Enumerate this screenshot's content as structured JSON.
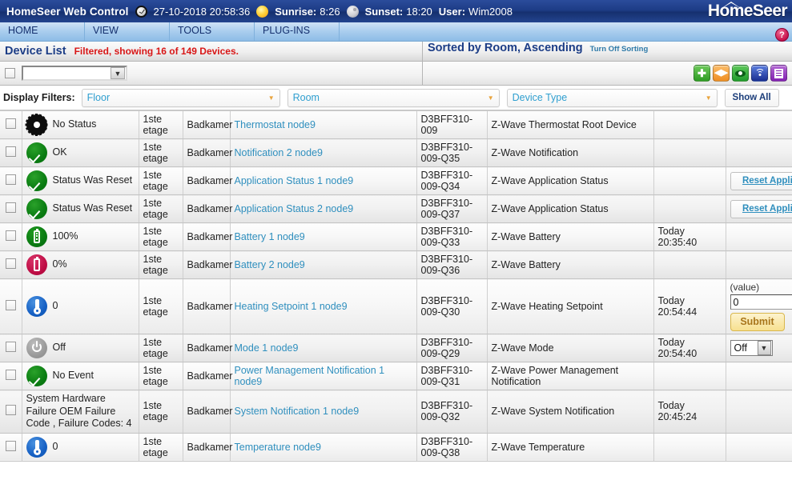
{
  "header": {
    "app_title": "HomeSeer Web Control",
    "clock_icon": "clock-icon",
    "datetime": "27-10-2018 20:58:36",
    "sun_icon": "sun-icon",
    "sunrise_label": "Sunrise:",
    "sunrise_value": "8:26",
    "moon_icon": "moon-icon",
    "sunset_label": "Sunset:",
    "sunset_value": "18:20",
    "user_label": "User:",
    "user_value": "Wim2008",
    "logo": "HomeSeer"
  },
  "menu": {
    "items": [
      {
        "label": "HOME"
      },
      {
        "label": "VIEW"
      },
      {
        "label": "TOOLS"
      },
      {
        "label": "PLUG-INS"
      }
    ],
    "help_icon_label": "?"
  },
  "listhead": {
    "title": "Device List",
    "filtered_text": "Filtered, showing 16 of 149 Devices.",
    "sorted_text": "Sorted by Room, Ascending",
    "turn_off_sorting": "Turn Off Sorting"
  },
  "toolbar": {
    "select_all_checkbox": "",
    "action_select_value": "",
    "buttons": [
      {
        "name": "add-device-button",
        "icon": "plus-icon"
      },
      {
        "name": "move-device-button",
        "icon": "left-right-arrows-icon"
      },
      {
        "name": "view-device-button",
        "icon": "eye-icon"
      },
      {
        "name": "zwave-signal-button",
        "icon": "wifi-signal-icon"
      },
      {
        "name": "device-list-button",
        "icon": "list-icon"
      }
    ]
  },
  "filters": {
    "label": "Display Filters:",
    "floor": "Floor",
    "room": "Room",
    "device_type": "Device Type",
    "show_all": "Show All"
  },
  "colors": {
    "accent_blue": "#1c3d86",
    "link_blue": "#2f8fbe",
    "alert_red": "#d81616",
    "filter_teal": "#2f9fd0",
    "submit_yellow": "#f7e08f"
  },
  "rows": [
    {
      "status": "No Status",
      "status_icon": "gear-icon",
      "icon_kind": "gear",
      "floor": "1ste etage",
      "room": "Badkamer",
      "name": "Thermostat node9",
      "code": "D3BFF310-009",
      "type": "Z-Wave Thermostat Root Device",
      "last_change": "",
      "control": {
        "kind": "none"
      }
    },
    {
      "status": "OK",
      "status_icon": "check-circle-icon",
      "icon_kind": "ok",
      "floor": "1ste etage",
      "room": "Badkamer",
      "name": "Notification 2 node9",
      "code": "D3BFF310-009-Q35",
      "type": "Z-Wave Notification",
      "last_change": "",
      "control": {
        "kind": "none"
      }
    },
    {
      "status": "Status Was Reset",
      "status_icon": "check-circle-icon",
      "icon_kind": "ok",
      "floor": "1ste etage",
      "room": "Badkamer",
      "name": "Application Status 1 node9",
      "code": "D3BFF310-009-Q34",
      "type": "Z-Wave Application Status",
      "last_change": "",
      "control": {
        "kind": "button",
        "label": "Reset Application Status"
      }
    },
    {
      "status": "Status Was Reset",
      "status_icon": "check-circle-icon",
      "icon_kind": "ok",
      "floor": "1ste etage",
      "room": "Badkamer",
      "name": "Application Status 2 node9",
      "code": "D3BFF310-009-Q37",
      "type": "Z-Wave Application Status",
      "last_change": "",
      "control": {
        "kind": "button",
        "label": "Reset Application Status"
      }
    },
    {
      "status": "100%",
      "status_icon": "battery-full-icon",
      "icon_kind": "batt-green",
      "floor": "1ste etage",
      "room": "Badkamer",
      "name": "Battery 1 node9",
      "code": "D3BFF310-009-Q33",
      "type": "Z-Wave Battery",
      "last_change": "Today 20:35:40",
      "control": {
        "kind": "none"
      }
    },
    {
      "status": "0%",
      "status_icon": "battery-empty-icon",
      "icon_kind": "batt-red",
      "floor": "1ste etage",
      "room": "Badkamer",
      "name": "Battery 2 node9",
      "code": "D3BFF310-009-Q36",
      "type": "Z-Wave Battery",
      "last_change": "",
      "control": {
        "kind": "none"
      }
    },
    {
      "status": "0",
      "status_icon": "thermometer-icon",
      "icon_kind": "temp",
      "floor": "1ste etage",
      "room": "Badkamer",
      "name": "Heating Setpoint 1 node9",
      "code": "D3BFF310-009-Q30",
      "type": "Z-Wave Heating Setpoint",
      "last_change": "Today 20:54:44",
      "control": {
        "kind": "value-input",
        "label": "(value)",
        "value": "0",
        "submit_label": "Submit"
      }
    },
    {
      "status": "Off",
      "status_icon": "power-icon",
      "icon_kind": "off",
      "floor": "1ste etage",
      "room": "Badkamer",
      "name": "Mode 1 node9",
      "code": "D3BFF310-009-Q29",
      "type": "Z-Wave Mode",
      "last_change": "Today 20:54:40",
      "control": {
        "kind": "select",
        "value": "Off"
      }
    },
    {
      "status": "No Event",
      "status_icon": "check-circle-icon",
      "icon_kind": "ok",
      "floor": "1ste etage",
      "room": "Badkamer",
      "name": "Power Management Notification 1 node9",
      "code": "D3BFF310-009-Q31",
      "type": "Z-Wave Power Management Notification",
      "last_change": "",
      "control": {
        "kind": "none"
      }
    },
    {
      "status": "System Hardware Failure OEM Failure Code , Failure Codes: 4",
      "status_icon": "",
      "icon_kind": "none",
      "floor": "1ste etage",
      "room": "Badkamer",
      "name": "System Notification 1 node9",
      "code": "D3BFF310-009-Q32",
      "type": "Z-Wave System Notification",
      "last_change": "Today 20:45:24",
      "control": {
        "kind": "none"
      }
    },
    {
      "status": "0",
      "status_icon": "thermometer-icon",
      "icon_kind": "temp",
      "floor": "1ste etage",
      "room": "Badkamer",
      "name": "Temperature node9",
      "code": "D3BFF310-009-Q38",
      "type": "Z-Wave Temperature",
      "last_change": "",
      "control": {
        "kind": "none"
      }
    }
  ]
}
